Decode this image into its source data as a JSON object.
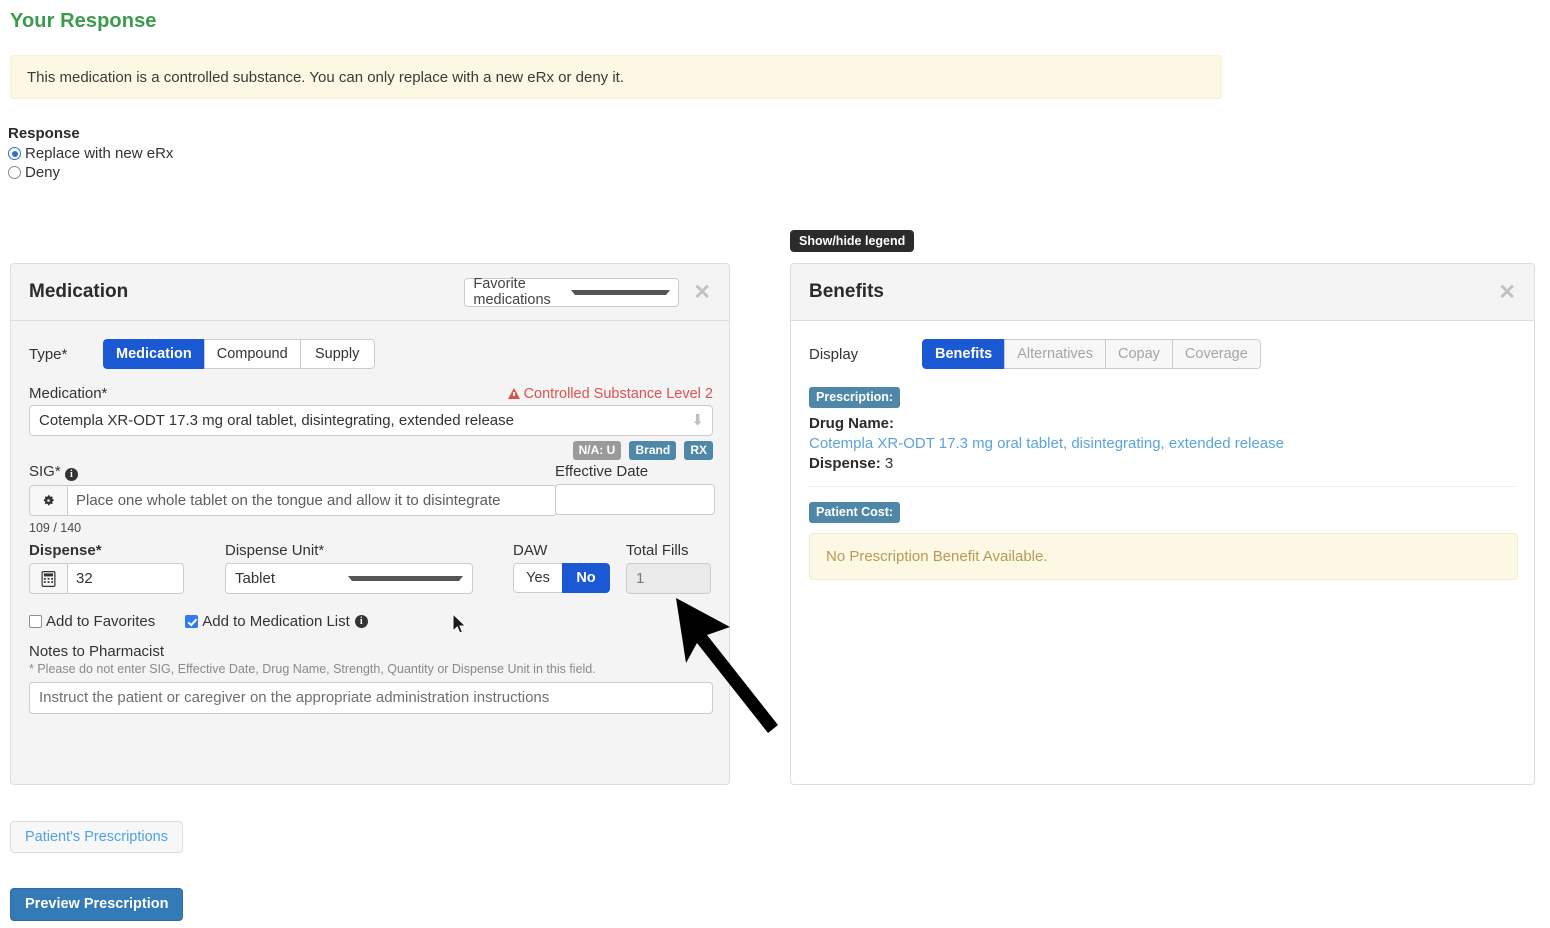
{
  "page": {
    "title": "Your Response",
    "alert": "This medication is a controlled substance. You can only replace with a new eRx or deny it.",
    "accent_green": "#3c9a4e",
    "accent_blue": "#1b58d4"
  },
  "response": {
    "label": "Response",
    "options": [
      {
        "label": "Replace with new eRx",
        "selected": true
      },
      {
        "label": "Deny",
        "selected": false
      }
    ]
  },
  "medication_panel": {
    "title": "Medication",
    "favorites_select": {
      "value": "Favorite medications"
    },
    "close_icon": "close-icon",
    "type": {
      "label": "Type*",
      "options": [
        "Medication",
        "Compound",
        "Supply"
      ],
      "selected": "Medication"
    },
    "medication": {
      "label": "Medication*",
      "value": "Cotempla XR-ODT 17.3 mg oral tablet, disintegrating, extended release",
      "warning": "Controlled Substance Level 2"
    },
    "badges": [
      {
        "text": "N/A: U",
        "style": "gray"
      },
      {
        "text": "Brand",
        "style": "blue"
      },
      {
        "text": "RX",
        "style": "blue"
      }
    ],
    "sig": {
      "label": "SIG*",
      "icon": "gear-icon",
      "placeholder": "Place one whole tablet on the tongue and allow it to disintegrate",
      "char_count": "109 / 140"
    },
    "effective_date": {
      "label": "Effective Date",
      "value": ""
    },
    "dispense": {
      "label": "Dispense*",
      "icon": "calculator-icon",
      "value": "32"
    },
    "dispense_unit": {
      "label": "Dispense Unit*",
      "value": "Tablet"
    },
    "daw": {
      "label": "DAW",
      "options": [
        "Yes",
        "No"
      ],
      "selected": "No"
    },
    "total_fills": {
      "label": "Total Fills",
      "value": "1",
      "disabled": true
    },
    "add_to_favorites": {
      "label": "Add to Favorites",
      "checked": false
    },
    "add_to_medication_list": {
      "label": "Add to Medication List",
      "checked": true
    },
    "notes": {
      "label": "Notes to Pharmacist",
      "hint": "* Please do not enter SIG, Effective Date, Drug Name, Strength, Quantity or Dispense Unit in this field.",
      "placeholder": "Instruct the patient or caregiver on the appropriate administration instructions"
    }
  },
  "benefits_panel": {
    "legend_tooltip": "Show/hide legend",
    "title": "Benefits",
    "close_icon": "close-icon",
    "display": {
      "label": "Display",
      "options": [
        {
          "label": "Benefits",
          "active": true,
          "disabled": false
        },
        {
          "label": "Alternatives",
          "active": false,
          "disabled": true
        },
        {
          "label": "Copay",
          "active": false,
          "disabled": true
        },
        {
          "label": "Coverage",
          "active": false,
          "disabled": true
        }
      ]
    },
    "prescription": {
      "tag": "Prescription:",
      "drug_name_label": "Drug Name:",
      "drug_name": "Cotempla XR-ODT 17.3 mg oral tablet, disintegrating, extended release",
      "dispense_label": "Dispense:",
      "dispense_value": "3"
    },
    "patient_cost": {
      "tag": "Patient Cost:",
      "message": "No Prescription Benefit Available."
    }
  },
  "footer": {
    "patients_prescriptions": "Patient's Prescriptions",
    "preview_prescription": "Preview Prescription"
  }
}
